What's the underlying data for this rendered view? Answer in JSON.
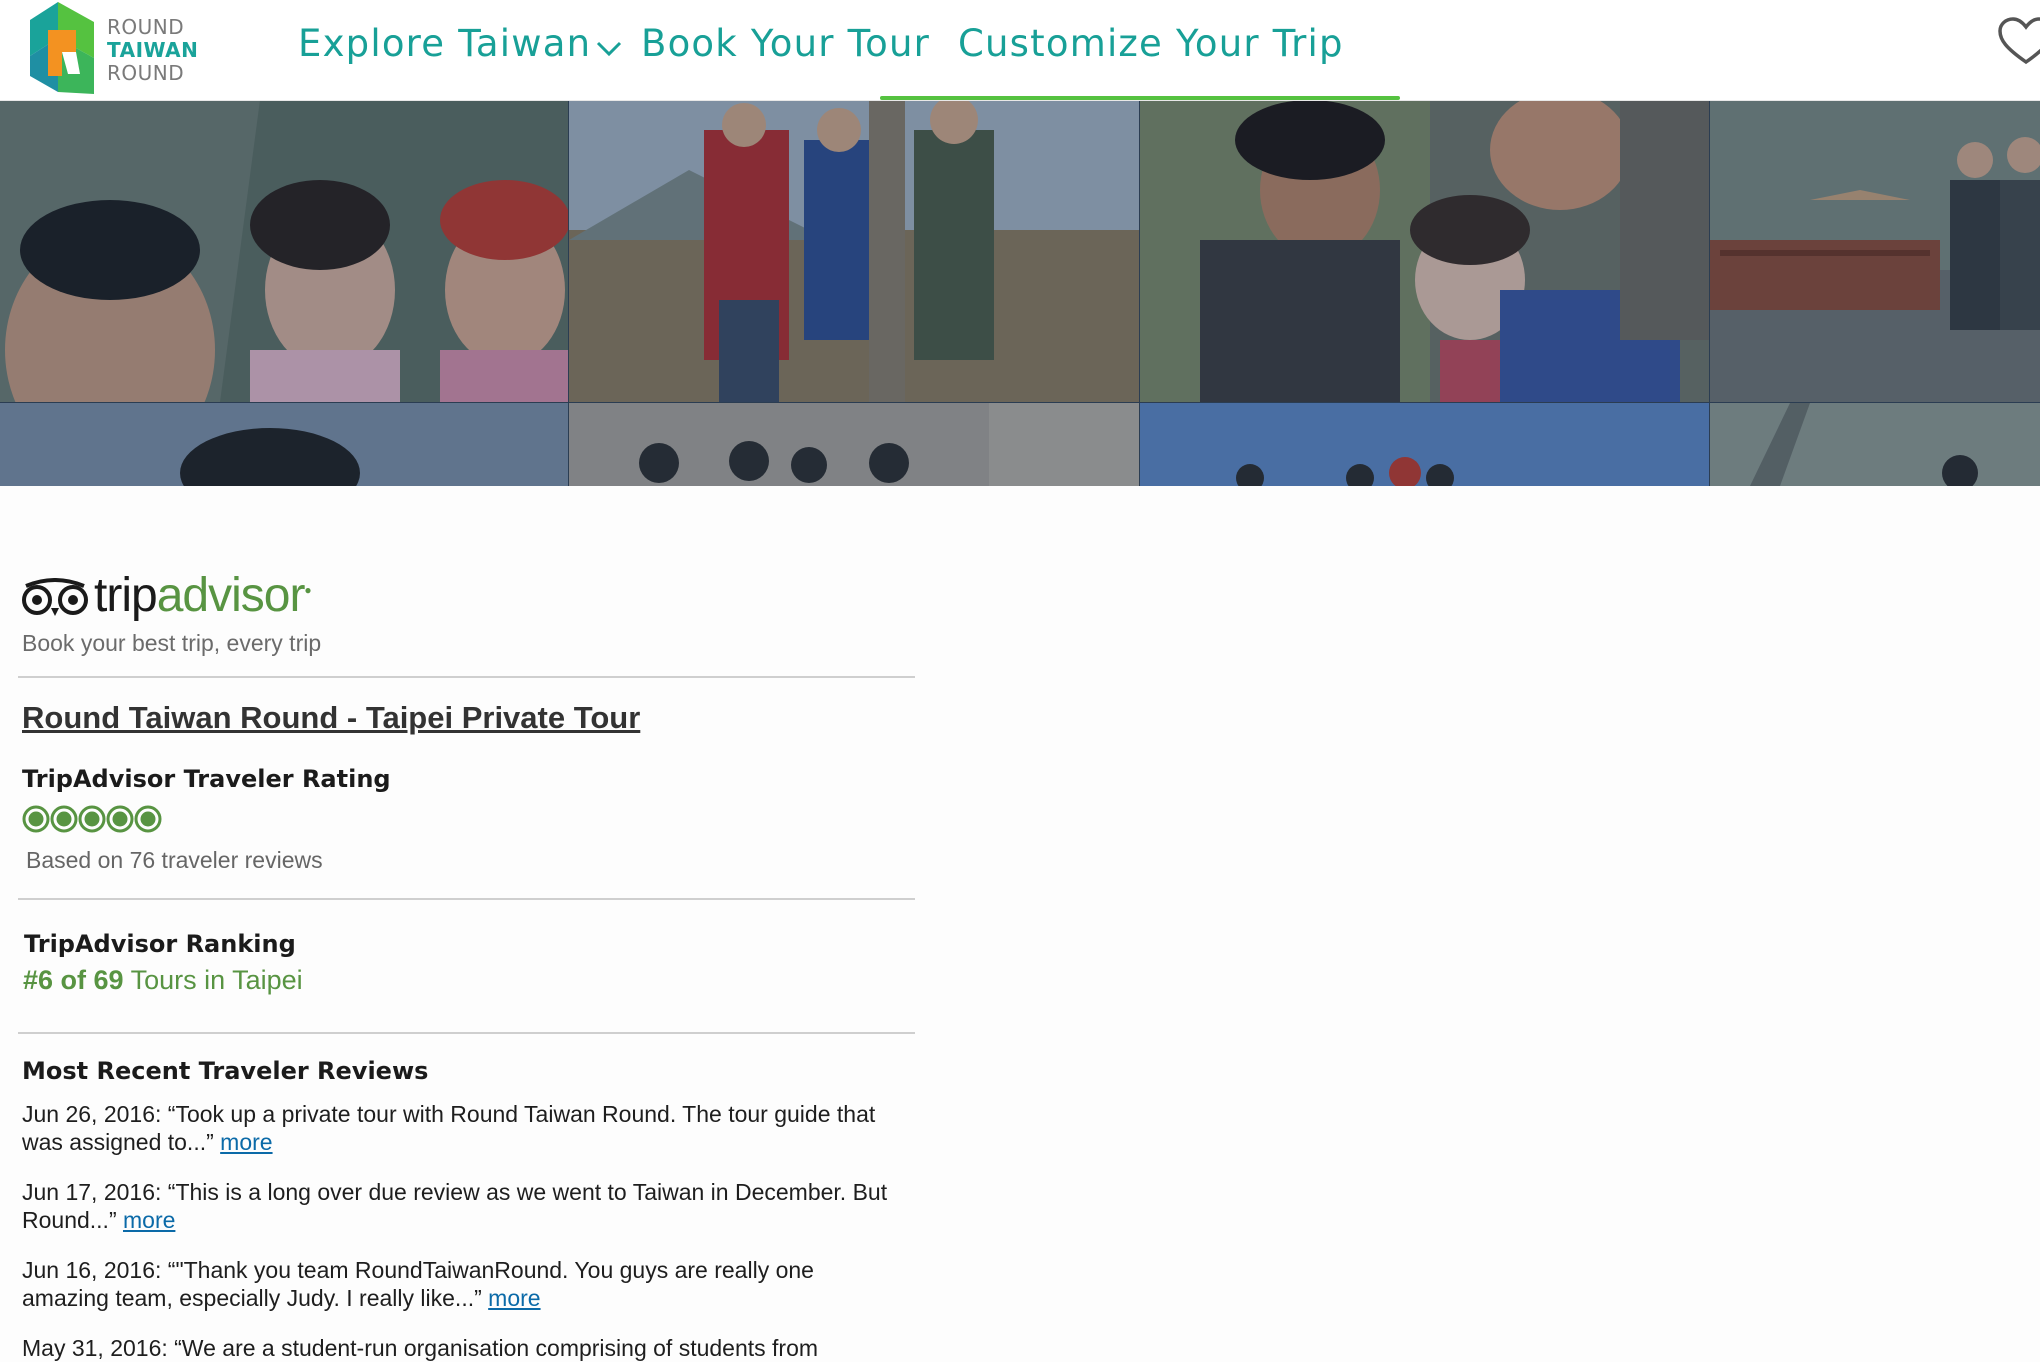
{
  "brand": {
    "line1": "ROUND",
    "line2": "TAIWAN",
    "line3": "ROUND",
    "colors": {
      "teal": "#18a097",
      "orange": "#f39221",
      "green": "#55c240"
    }
  },
  "nav": {
    "items": [
      {
        "label": "Explore Taiwan",
        "icon": "chevron-down-icon"
      },
      {
        "label": "Book Your Tour"
      },
      {
        "label": "Customize Your Trip"
      }
    ],
    "favorites_icon": "heart-icon"
  },
  "widget": {
    "brand_trip": "trip",
    "brand_advisor": "advisor",
    "tagline": "Book your best trip, every trip",
    "tour_title": "Round Taiwan Round - Taipei Private Tour",
    "rating_label": "TripAdvisor Traveler Rating",
    "rating_value": 5,
    "rating_max": 5,
    "based_on": "Based on 76 traveler reviews",
    "ranking_label": "TripAdvisor Ranking",
    "ranking_rank": "#6 of 69",
    "ranking_rest": "Tours in Taipei",
    "reviews_heading": "Most Recent Traveler Reviews",
    "more_label": "more",
    "reviews": [
      {
        "text": "Jun 26, 2016: “Took up a private tour with Round Taiwan Round. The tour guide that was assigned to...”"
      },
      {
        "text": "Jun 17, 2016: “This is a long over due review as we went to Taiwan in December. But Round...”"
      },
      {
        "text": "Jun 16, 2016: “\"Thank you team RoundTaiwanRound. You guys are really one amazing team, especially Judy. I really like...”"
      },
      {
        "text": "May 31, 2016: “We are a student-run organisation comprising of students from"
      }
    ],
    "accent_color": "#589442"
  }
}
